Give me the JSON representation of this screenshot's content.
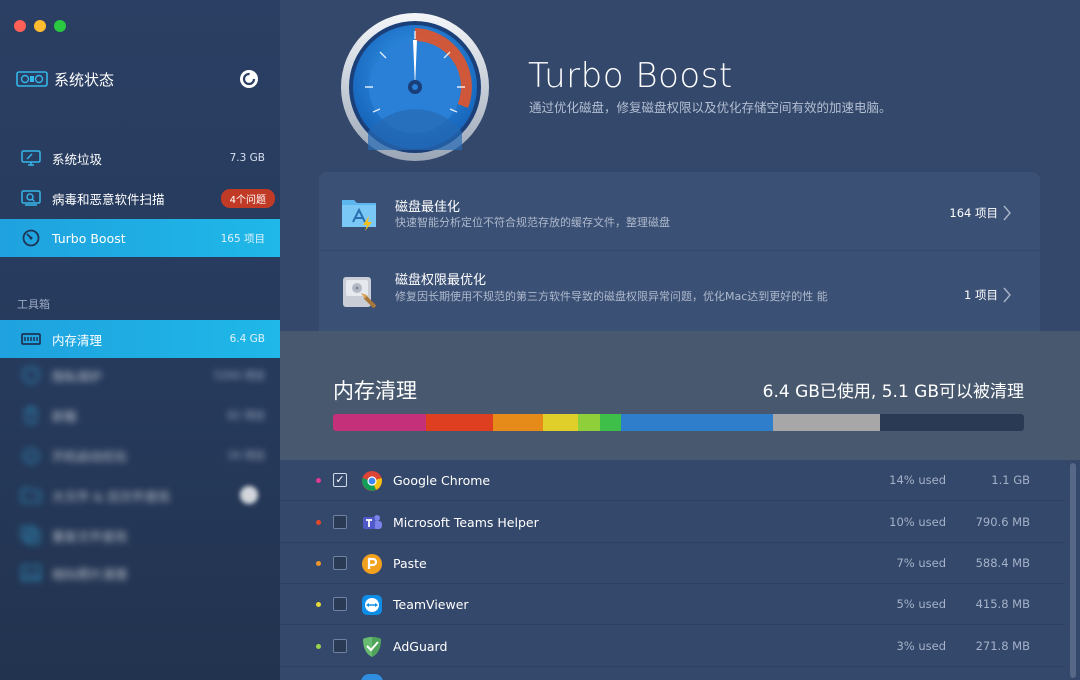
{
  "window": {
    "controls": [
      {
        "name": "close",
        "color": "#fe5f57"
      },
      {
        "name": "minimize",
        "color": "#febc2e"
      },
      {
        "name": "zoom",
        "color": "#29c840"
      }
    ]
  },
  "sidebar": {
    "status_label": "系统状态",
    "items": [
      {
        "label": "系统垃圾",
        "value": "7.3 GB",
        "icon": "monitor-broom-icon"
      },
      {
        "label": "病毒和恶意软件扫描",
        "badge": "4个问题",
        "icon": "scan-icon"
      },
      {
        "label": "Turbo Boost",
        "value": "165 项目",
        "icon": "speedometer-icon",
        "active": true
      }
    ],
    "tools_header": "工具箱",
    "tools": [
      {
        "label": "内存清理",
        "value": "6.4 GB",
        "icon": "memory-chip-icon",
        "active": true
      },
      {
        "label": "隐私保护",
        "value": "5344 项目",
        "icon": "shield-icon",
        "blurred": true
      },
      {
        "label": "卸载",
        "value": "82 项目",
        "icon": "trash-icon",
        "blurred": true
      },
      {
        "label": "开机启动优化",
        "value": "34 项目",
        "icon": "power-icon",
        "blurred": true
      },
      {
        "label": "大文件 & 旧文件查找",
        "value": "",
        "icon": "folder-icon",
        "blurred": true
      },
      {
        "label": "重复文件查找",
        "value": "",
        "icon": "duplicate-icon",
        "blurred": true
      },
      {
        "label": "相似照片清理",
        "value": "",
        "icon": "photo-icon",
        "blurred": true
      }
    ]
  },
  "hero": {
    "title": "Turbo Boost",
    "subtitle": "通过优化磁盘，修复磁盘权限以及优化存储空间有效的加速电脑。"
  },
  "features": [
    {
      "title": "磁盘最佳化",
      "desc": "快速智能分析定位不符合规范存放的缓存文件，整理磁盘",
      "count": "164 项目",
      "icon": "app-store-folder-icon"
    },
    {
      "title": "磁盘权限最优化",
      "desc": "修复因长期使用不规范的第三方软件导致的磁盘权限异常问题，优化Mac达到更好的性 能",
      "count": "1 项目",
      "icon": "disk-utility-icon"
    }
  ],
  "memory": {
    "title": "内存清理",
    "usage": "6.4 GB已使用, 5.1 GB可以被清理",
    "segments": [
      {
        "name": "Google Chrome",
        "fraction": 0.135,
        "color": "#c4307a"
      },
      {
        "name": "Microsoft Teams Helper",
        "fraction": 0.097,
        "color": "#dd3f20"
      },
      {
        "name": "Paste",
        "fraction": 0.072,
        "color": "#e68a1a"
      },
      {
        "name": "TeamViewer",
        "fraction": 0.05,
        "color": "#e0cf2a"
      },
      {
        "name": "AdGuard",
        "fraction": 0.033,
        "color": "#8fcf3a"
      },
      {
        "name": "other-green",
        "fraction": 0.03,
        "color": "#3dbf4a"
      },
      {
        "name": "other-blue",
        "fraction": 0.22,
        "color": "#2f7ecb"
      },
      {
        "name": "other-gray",
        "fraction": 0.155,
        "color": "#a7a7a7"
      }
    ]
  },
  "processes": [
    {
      "name": "Google Chrome",
      "pct": "14% used",
      "size": "1.1 GB",
      "dot": "#e03a93",
      "checked": true,
      "icon": "chrome-icon"
    },
    {
      "name": "Microsoft Teams Helper",
      "pct": "10% used",
      "size": "790.6 MB",
      "dot": "#e5472a",
      "checked": false,
      "icon": "teams-icon"
    },
    {
      "name": "Paste",
      "pct": "7% used",
      "size": "588.4 MB",
      "dot": "#f0962a",
      "checked": false,
      "icon": "paste-icon"
    },
    {
      "name": "TeamViewer",
      "pct": "5% used",
      "size": "415.8 MB",
      "dot": "#e6d83a",
      "checked": false,
      "icon": "teamviewer-icon"
    },
    {
      "name": "AdGuard",
      "pct": "3% used",
      "size": "271.8 MB",
      "dot": "#9bd34a",
      "checked": false,
      "icon": "adguard-icon"
    }
  ]
}
